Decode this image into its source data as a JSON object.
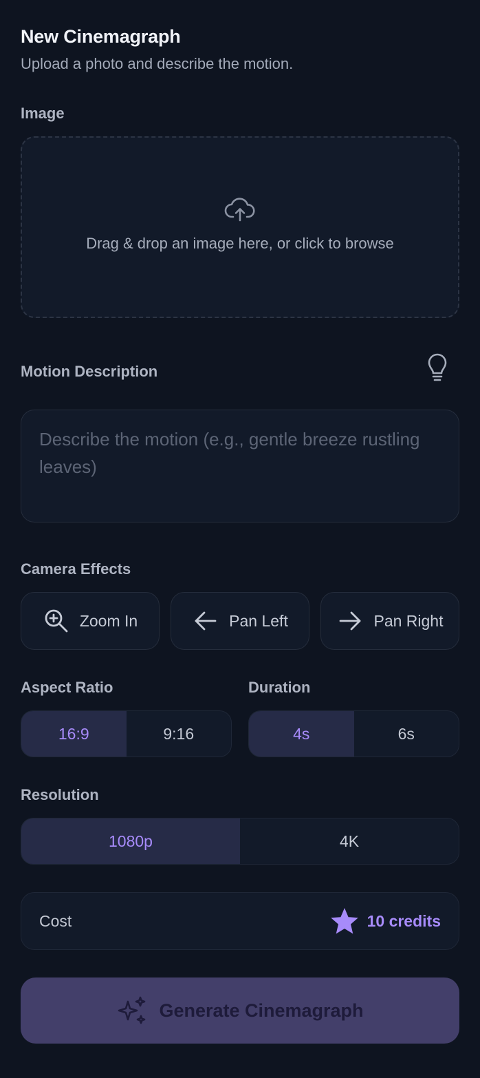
{
  "header": {
    "title": "New Cinemagraph",
    "subtitle": "Upload a photo and describe the motion."
  },
  "image": {
    "label": "Image",
    "dropzone_text": "Drag & drop an image here, or click to browse",
    "icon": "cloud-upload-icon"
  },
  "motion": {
    "label": "Motion Description",
    "placeholder": "Describe the motion (e.g., gentle breeze rustling leaves)",
    "value": "",
    "hint_icon": "lightbulb-icon"
  },
  "camera_effects": {
    "label": "Camera Effects",
    "items": [
      {
        "label": "Zoom In",
        "icon": "zoom-in-icon"
      },
      {
        "label": "Pan Left",
        "icon": "arrow-left-icon"
      },
      {
        "label": "Pan Right",
        "icon": "arrow-right-icon"
      }
    ]
  },
  "aspect_ratio": {
    "label": "Aspect Ratio",
    "options": [
      "16:9",
      "9:16"
    ],
    "selected": "16:9"
  },
  "duration": {
    "label": "Duration",
    "options": [
      "4s",
      "6s"
    ],
    "selected": "4s"
  },
  "resolution": {
    "label": "Resolution",
    "options": [
      "1080p",
      "4K"
    ],
    "selected": "1080p"
  },
  "cost": {
    "label": "Cost",
    "value": "10 credits",
    "icon": "star-icon"
  },
  "generate": {
    "label": "Generate Cinemagraph",
    "icon": "sparkles-icon"
  },
  "colors": {
    "background": "#0e1420",
    "surface": "#121a29",
    "accent": "#a78bfa",
    "active_segment": "#262b47",
    "generate_button": "#433f6a"
  }
}
